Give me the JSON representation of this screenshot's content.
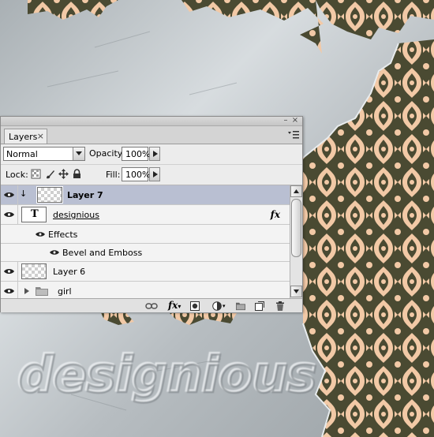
{
  "panel": {
    "tab_label": "Layers",
    "blend_mode": "Normal",
    "opacity_label": "Opacity:",
    "opacity_value": "100%",
    "lock_label": "Lock:",
    "fill_label": "Fill:",
    "fill_value": "100%"
  },
  "layers": [
    {
      "name": "Layer 7",
      "selected": true,
      "thumb": "transparent"
    },
    {
      "name": "designious",
      "thumb": "type",
      "fx": "fx"
    },
    {
      "name": "Effects"
    },
    {
      "name": "Bevel and Emboss"
    },
    {
      "name": "Layer 6",
      "thumb": "transparent"
    },
    {
      "name": "girl",
      "kind": "group"
    }
  ],
  "icons": [
    "eye-icon",
    "close-icon",
    "panel-menu-icon",
    "chevron-down-icon",
    "link-icon",
    "fx-icon",
    "mask-icon",
    "adjustment-icon",
    "folder-icon",
    "new-layer-icon",
    "trash-icon",
    "lock-icon",
    "move-icon",
    "brush-icon",
    "transparency-lock-icon"
  ],
  "colors": {
    "selected_row": "#b9bfd2",
    "panel_bg": "#ececec",
    "pattern_dark": "#4a4a32",
    "pattern_light": "#f2c9a6"
  }
}
